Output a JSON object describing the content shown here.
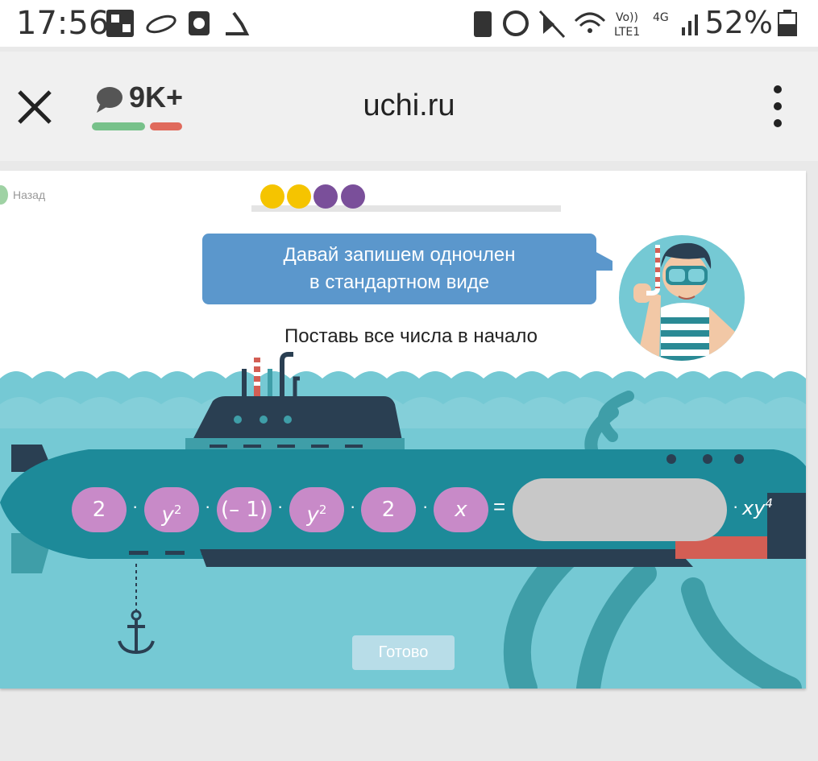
{
  "status_bar": {
    "time": "17:56",
    "battery": "52%"
  },
  "app_bar": {
    "comments": "9K+",
    "url": "uchi.ru"
  },
  "game": {
    "back_label": "Назад",
    "bubble_line1": "Давай запишем одночлен",
    "bubble_line2": "в стандартном виде",
    "instruction": "Поставь все числа в начало",
    "cards": [
      "2",
      "y",
      "(– 1)",
      "y",
      "2",
      "x"
    ],
    "card_exponents": [
      "",
      "2",
      "",
      "2",
      "",
      ""
    ],
    "multiply_sign": "·",
    "equals_sign": "=",
    "suffix": "xy",
    "suffix_exponent": "4",
    "done_button": "Готово",
    "progress_dots": [
      "#f5c400",
      "#f5c400",
      "#7a4f9a",
      "#7a4f9a"
    ]
  }
}
